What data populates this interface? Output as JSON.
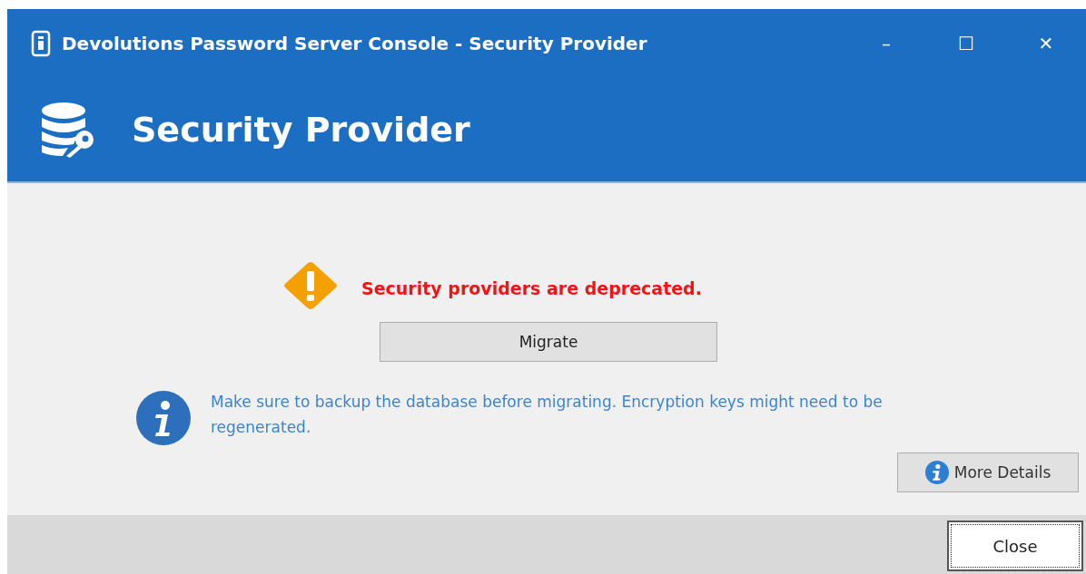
{
  "window": {
    "title": "Devolutions Password Server Console - Security Provider",
    "controls": [
      "–",
      "☐",
      "✕"
    ]
  },
  "header": {
    "title": "Security Provider"
  },
  "warning": {
    "message": "Security providers are deprecated."
  },
  "migrate_button": {
    "label": "Migrate"
  },
  "info": {
    "message": "Make sure to backup the database before migrating. Encryption keys might need to be regenerated."
  },
  "more_details_button": {
    "label": "More Details"
  },
  "footer": {
    "close_button": {
      "label": "Close"
    }
  }
}
